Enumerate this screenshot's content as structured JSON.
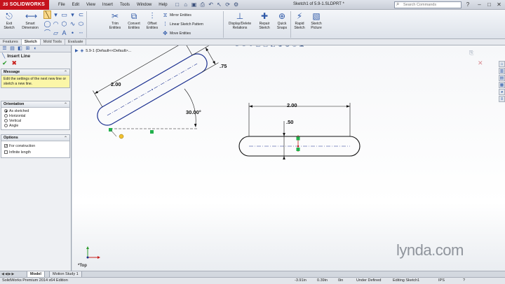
{
  "titlebar": {
    "logo_prefix": "3S",
    "logo": "SOLIDWORKS",
    "menus": [
      "File",
      "Edit",
      "View",
      "Insert",
      "Tools",
      "Window",
      "Help"
    ],
    "window_title": "Sketch1 of 5.9-1.SLDPRT *",
    "search_placeholder": "Search Commands"
  },
  "command_manager": {
    "exit_sketch": "Exit\nSketch",
    "smart_dimension": "Smart\nDimension",
    "trim": "Trim\nEntities",
    "convert": "Convert\nEntities",
    "offset": "Offset\nEntities",
    "mirror": "Mirror Entities",
    "linear_pattern": "Linear Sketch Pattern",
    "move": "Move Entities",
    "display_delete": "Display/Delete\nRelations",
    "repair": "Repair\nSketch",
    "quick_snaps": "Quick\nSnaps",
    "rapid_sketch": "Rapid\nSketch",
    "sketch_picture": "Sketch\nPicture"
  },
  "tabs": [
    "Features",
    "Sketch",
    "Mold Tools",
    "Evaluate"
  ],
  "active_tab": "Sketch",
  "property_manager": {
    "title": "Insert Line",
    "message_header": "Message",
    "message": "Edit the settings of the next new line or sketch a new line.",
    "orientation_header": "Orientation",
    "orientation_options": [
      "As sketched",
      "Horizontal",
      "Vertical",
      "Angle"
    ],
    "orientation_selected": "As sketched",
    "options_header": "Options",
    "for_construction": "For construction",
    "infinite_length": "Infinite length"
  },
  "graphics": {
    "tree_label": "5.9-1  (Default<<Default>...",
    "view_label": "*Top",
    "watermark_main": "lynda",
    "watermark_dot": ".",
    "watermark_tld": "com",
    "dims": {
      "slot1_length": "2.00",
      "slot1_width": ".75",
      "slot1_angle": "30.00°",
      "slot2_length": "2.00",
      "slot2_width": ".50"
    }
  },
  "bottom_tabs": [
    "Model",
    "Motion Study 1"
  ],
  "active_bottom_tab": "Model",
  "statusbar": {
    "edition": "SolidWorks Premium 2014 x64 Edition",
    "x": "-3.91in",
    "y": "0.39in",
    "z": "0in",
    "state": "Under Defined",
    "editing": "Editing Sketch1",
    "units": "IPS"
  },
  "colors": {
    "logo_red": "#c5131d",
    "sketch_blue": "#1a2f8f",
    "relation_green": "#22b14c",
    "active_tool": "#f9d98c"
  }
}
